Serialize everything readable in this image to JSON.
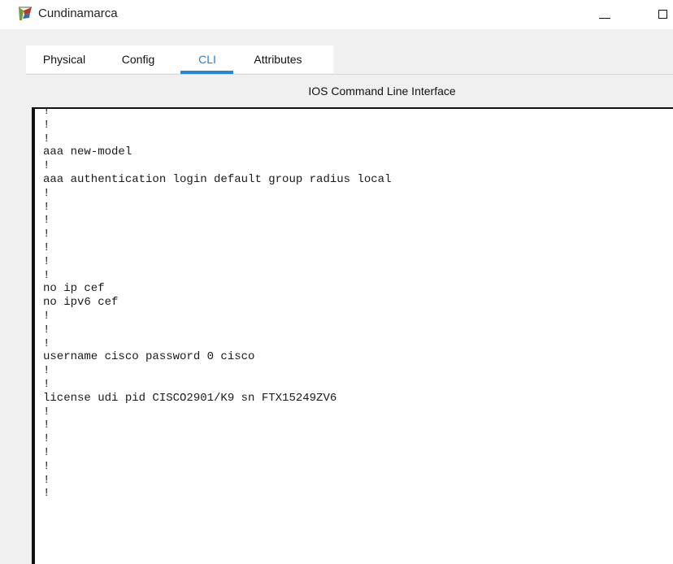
{
  "window": {
    "title": "Cundinamarca",
    "icon": "cisco-router-icon"
  },
  "tabs": [
    {
      "label": "Physical",
      "selected": false
    },
    {
      "label": "Config",
      "selected": false
    },
    {
      "label": "CLI",
      "selected": true
    },
    {
      "label": "Attributes",
      "selected": false
    }
  ],
  "panel": {
    "title": "IOS Command Line Interface"
  },
  "terminal": {
    "lines": [
      "!",
      "!",
      "!",
      "aaa new-model",
      "!",
      "aaa authentication login default group radius local",
      "!",
      "!",
      "!",
      "!",
      "!",
      "!",
      "!",
      "no ip cef",
      "no ipv6 cef",
      "!",
      "!",
      "!",
      "username cisco password 0 cisco",
      "!",
      "!",
      "license udi pid CISCO2901/K9 sn FTX15249ZV6",
      "!",
      "!",
      "!",
      "!",
      "!",
      "!",
      "!"
    ]
  },
  "colors": {
    "accent": "#2a86cc",
    "terminal_bg": "#ffffff",
    "client_bg": "#f0f0f0"
  }
}
